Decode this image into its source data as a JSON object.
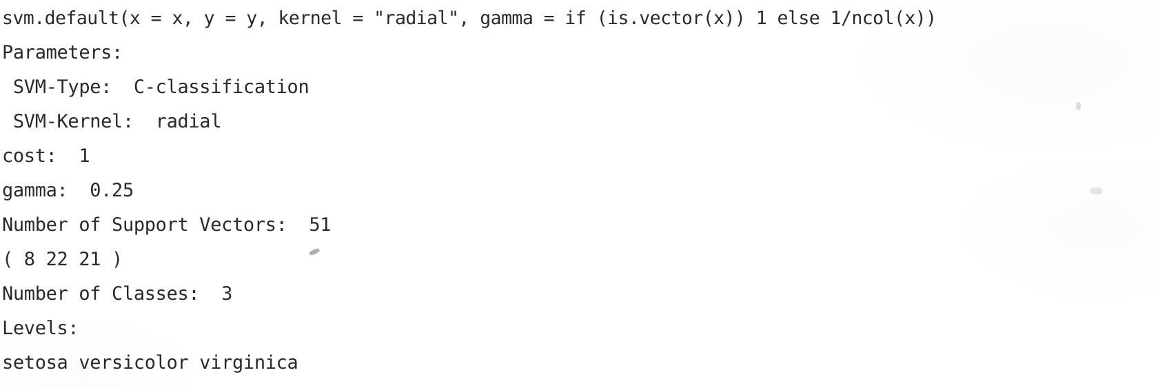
{
  "document": {
    "type": "scanned-console-output",
    "source_kind": "r-console-svm-summary",
    "background_color": "#ffffff",
    "text_color": "#1d1d1d"
  },
  "call": {
    "text": "svm.default(x = x, y = y, kernel = \"radial\", gamma = if (is.vector(x)) 1 else 1/ncol(x))"
  },
  "parameters_heading": {
    "text": "Parameters:"
  },
  "parameters": {
    "svm_type_label": "SVM-Type:",
    "svm_type_value": "C-classification",
    "svm_kernel_label": "SVM-Kernel:",
    "svm_kernel_value": "radial",
    "cost_label": "cost:",
    "cost_value": "1",
    "gamma_label": "gamma:",
    "gamma_value": "0.25"
  },
  "support_vectors": {
    "label": "Number of Support Vectors:",
    "total": "51",
    "per_class_text": "( 8 22 21 )",
    "per_class": [
      "8",
      "22",
      "21"
    ]
  },
  "classes": {
    "label": "Number of Classes:",
    "value": "3"
  },
  "levels": {
    "heading": "Levels:",
    "values_text": "setosa versicolor virginica",
    "values": [
      "setosa",
      "versicolor",
      "virginica"
    ]
  },
  "lines": [
    "svm.default(x = x, y = y, kernel = \"radial\", gamma = if (is.vector(x)) 1 else 1/ncol(x))",
    "Parameters:",
    " SVM-Type:  C-classification",
    " SVM-Kernel:  radial",
    "cost:  1",
    "gamma:  0.25",
    "Number of Support Vectors:  51",
    "( 8 22 21 )",
    "Number of Classes:  3",
    "Levels:",
    "setosa versicolor virginica"
  ]
}
